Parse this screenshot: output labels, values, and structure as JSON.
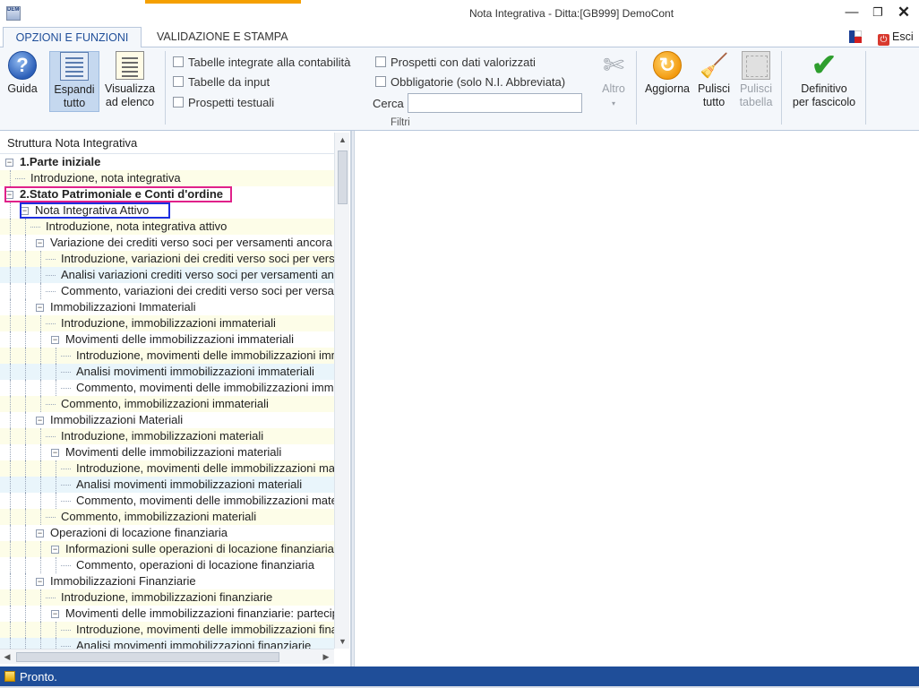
{
  "window": {
    "title": "Nota Integrativa - Ditta:[GB999] DemoCont",
    "minimize": "—",
    "maximize": "❐",
    "close": "✕",
    "app_icon_text": "DEMO"
  },
  "tabs": {
    "opzioni": "OPZIONI E FUNZIONI",
    "validazione": "VALIDAZIONE E STAMPA",
    "esci": "Esci"
  },
  "ribbon": {
    "guida": "Guida",
    "espandi_1": "Espandi",
    "espandi_2": "tutto",
    "visualizza_1": "Visualizza",
    "visualizza_2": "ad elenco",
    "altro": "Altro",
    "aggiorna": "Aggiorna",
    "pulisci_tutto_1": "Pulisci",
    "pulisci_tutto_2": "tutto",
    "pulisci_tabella_1": "Pulisci",
    "pulisci_tabella_2": "tabella",
    "definitivo_1": "Definitivo",
    "definitivo_2": "per fascicolo"
  },
  "filters": {
    "tabelle_integrate": "Tabelle integrate alla contabilità",
    "tabelle_input": "Tabelle da input",
    "prospetti_testuali": "Prospetti testuali",
    "prospetti_valorizzati": "Prospetti con dati valorizzati",
    "obbligatorie": "Obbligatorie (solo N.I. Abbreviata)",
    "cerca_label": "Cerca",
    "cerca_value": "",
    "group_label": "Filtri"
  },
  "tree": {
    "header": "Struttura Nota Integrativa",
    "rows": [
      "1.Parte iniziale",
      "Introduzione, nota integrativa",
      "2.Stato Patrimoniale e Conti d'ordine",
      "Nota Integrativa Attivo",
      "Introduzione, nota integrativa attivo",
      "Variazione dei crediti verso soci per versamenti ancora dovuti",
      "Introduzione, variazioni dei crediti verso soci per versamenti",
      "Analisi variazioni crediti verso soci per versamenti ancora dovuti",
      "Commento, variazioni dei crediti verso soci per versamenti",
      "Immobilizzazioni Immateriali",
      "Introduzione, immobilizzazioni immateriali",
      "Movimenti delle immobilizzazioni immateriali",
      "Introduzione, movimenti delle immobilizzazioni immateriali",
      "Analisi movimenti immobilizzazioni immateriali",
      "Commento, movimenti delle immobilizzazioni immateriali",
      "Commento, immobilizzazioni immateriali",
      "Immobilizzazioni Materiali",
      "Introduzione, immobilizzazioni materiali",
      "Movimenti delle immobilizzazioni materiali",
      "Introduzione, movimenti delle immobilizzazioni materiali",
      "Analisi movimenti immobilizzazioni materiali",
      "Commento, movimenti delle immobilizzazioni materiali",
      "Commento, immobilizzazioni materiali",
      "Operazioni di locazione finanziaria",
      "Informazioni sulle operazioni di locazione finanziaria",
      "Commento, operazioni di locazione finanziaria",
      "Immobilizzazioni Finanziarie",
      "Introduzione, immobilizzazioni finanziarie",
      "Movimenti delle immobilizzazioni finanziarie: partecipazioni",
      "Introduzione, movimenti delle immobilizzazioni finanziarie",
      "Analisi movimenti immobilizzazioni finanziarie"
    ]
  },
  "status": {
    "text": "Pronto."
  }
}
